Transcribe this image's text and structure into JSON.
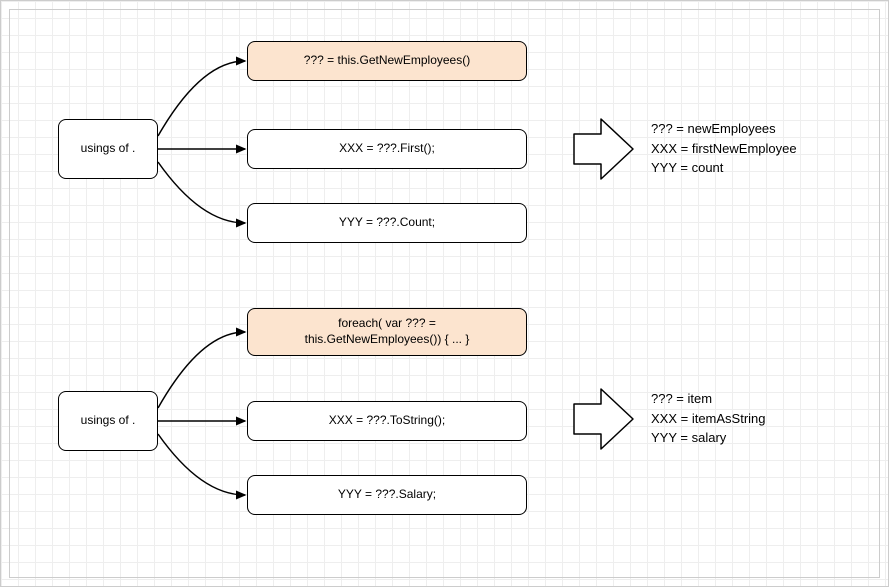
{
  "group1": {
    "source": "usings of .",
    "box1": "??? = this.GetNewEmployees()",
    "box2": "XXX = ???.First();",
    "box3": "YYY = ???.Count;",
    "result": "??? = newEmployees\nXXX = firstNewEmployee\nYYY = count"
  },
  "group2": {
    "source": "usings of .",
    "box1": "foreach( var ??? =\nthis.GetNewEmployees()) { ... }",
    "box2": "XXX = ???.ToString();",
    "box3": "YYY = ???.Salary;",
    "result": "??? = item\nXXX = itemAsString\nYYY = salary"
  }
}
